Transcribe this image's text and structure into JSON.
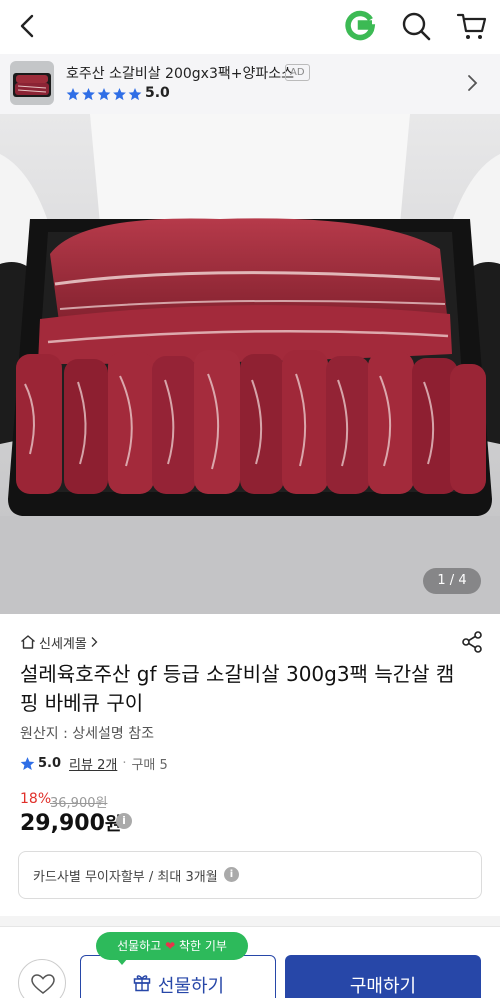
{
  "header": {
    "back_icon": "back-arrow-icon",
    "logo_icon": "g-logo-icon",
    "search_icon": "search-icon",
    "cart_icon": "cart-icon",
    "logo_color": "#3cba54"
  },
  "ad": {
    "title": "호주산 소갈비살 200gx3팩+양파소스",
    "tag": "AD",
    "stars": 5,
    "rating": "5.0",
    "star_color": "#2f6ee6"
  },
  "gallery": {
    "counter": "1 / 4"
  },
  "product": {
    "seller": "신세계몰",
    "title": "설레육호주산 gf 등급 소갈비살 300g3팩 늑간살 캠핑 바베큐 구이",
    "origin": "원산지 : 상세설명 참조",
    "score": "5.0",
    "reviews": "리뷰 2개",
    "purchases": "구매 5",
    "discount": "18%",
    "original_price": "36,900원",
    "price": "29,900",
    "price_unit": "원",
    "card_info": "카드사별 무이자할부 / 최대 3개월",
    "accent_color": "#2747a8",
    "discount_color": "#e0302a"
  },
  "footer": {
    "promo_left": "선물하고",
    "promo_right": "착한 기부",
    "gift_label": "선물하기",
    "buy_label": "구매하기",
    "promo_color": "#2dba5b"
  }
}
